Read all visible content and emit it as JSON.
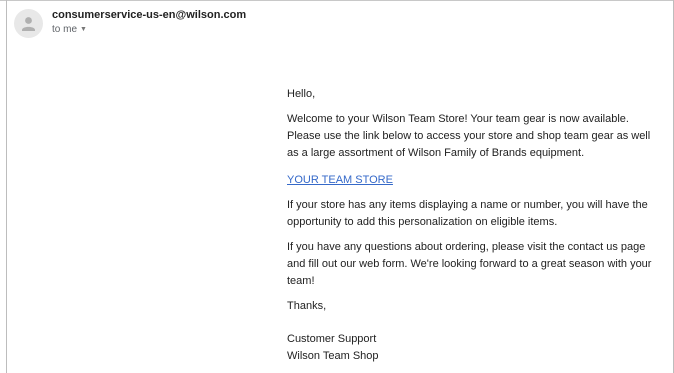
{
  "header": {
    "sender_email": "consumerservice-us-en@wilson.com",
    "recipient_label": "to me",
    "avatar_icon": "person-icon",
    "caret_icon": "chevron-down-icon"
  },
  "message": {
    "greeting": "Hello,",
    "welcome": "Welcome to your Wilson Team Store! Your team gear is now available. Please use the link below to access your store and shop team gear as well as a large assortment of Wilson Family of Brands equipment.",
    "store_link": "YOUR TEAM STORE",
    "personalization": "If your store has any items displaying a name or number, you will have the opportunity to add this personalization on eligible items.",
    "questions": "If you have any questions about ordering, please visit the contact us page and fill out our web form. We're looking forward to a great season with your team!",
    "thanks": "Thanks,",
    "signature_line1": "Customer Support",
    "signature_line2": "Wilson Team Shop"
  },
  "colors": {
    "link": "#3569c9",
    "avatar_bg": "#e8e8e8",
    "muted_text": "#5f6368"
  }
}
